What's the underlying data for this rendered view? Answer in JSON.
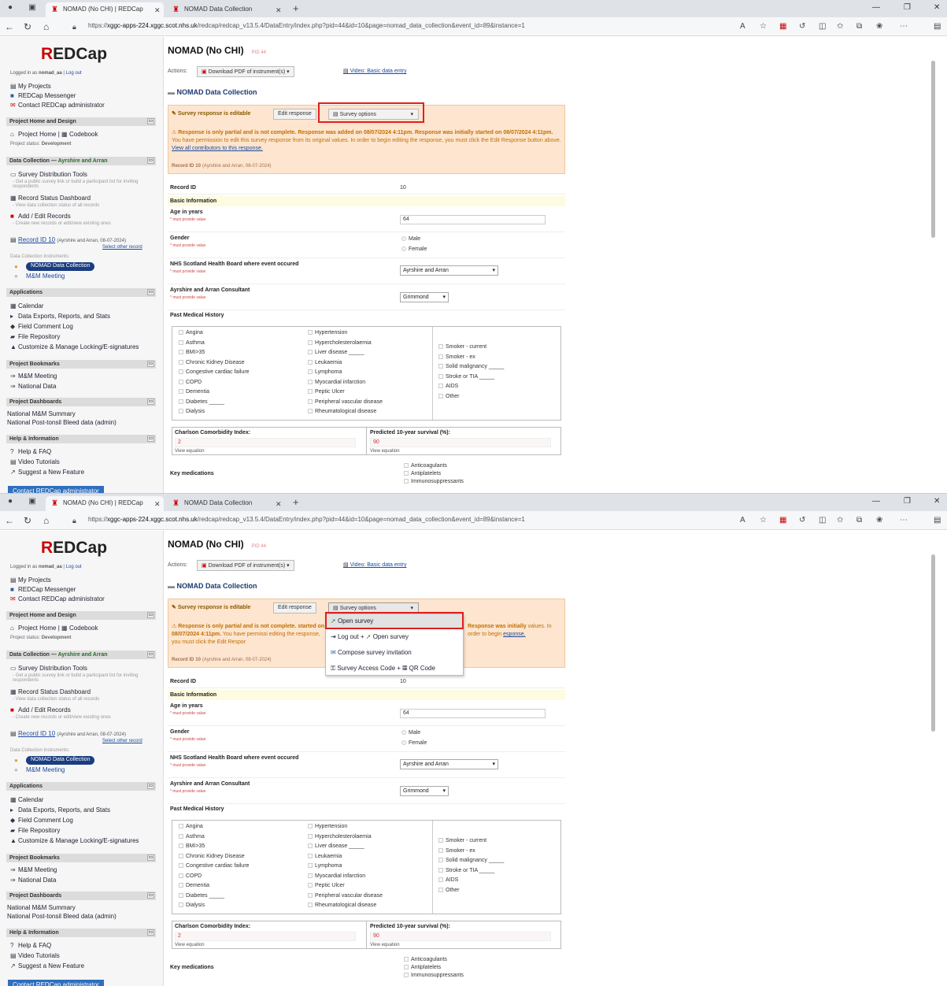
{
  "browser": {
    "tabs": [
      {
        "title": "NOMAD (No CHI) | REDCap"
      },
      {
        "title": "NOMAD Data Collection"
      }
    ],
    "url_prefix": "https://",
    "url_host": "xggc-apps-224.xggc.scot.nhs.uk",
    "url_path": "/redcap/redcap_v13.5.4/DataEntry/index.php?pid=44&id=10&page=nomad_data_collection&event_id=89&instance=1",
    "new_tab": "+"
  },
  "sidebar": {
    "logo_r": "R",
    "logo_rest": "EDCap",
    "logged_in_prefix": "Logged in as",
    "username": "nomad_aa",
    "sep": "|",
    "logout": "Log out",
    "top_links": [
      "My Projects",
      "REDCap Messenger",
      "Contact REDCap administrator"
    ],
    "sections": {
      "home_design": "Project Home and Design",
      "data_collection": "Data Collection",
      "data_collection_sub": "Ayrshire and Arran",
      "applications": "Applications",
      "bookmarks": "Project Bookmarks",
      "dashboards": "Project Dashboards",
      "help": "Help & Information"
    },
    "dash": "—",
    "collapse": "▭",
    "project_home": "Project Home",
    "codebook": "Codebook",
    "project_status_label": "Project status:",
    "project_status": "Development",
    "survey_tools": "Survey Distribution Tools",
    "survey_tools_desc": "- Get a public survey link or build a participant list for inviting respondents",
    "record_status": "Record Status Dashboard",
    "record_status_desc": "- View data collection status of all records",
    "add_edit": "Add / Edit Records",
    "add_edit_desc": "- Create new records or edit/view existing ones",
    "record_link": "Record ID 10",
    "record_ctx": "(Ayrshire and Arran, 08-07-2024)",
    "select_other": "Select other record",
    "instruments_label": "Data Collection Instruments:",
    "instruments": [
      "NOMAD Data Collection",
      "M&M Meeting"
    ],
    "applications": [
      "Calendar",
      "Data Exports, Reports, and Stats",
      "Field Comment Log",
      "File Repository",
      "Customize & Manage Locking/E-signatures"
    ],
    "bookmarks": [
      "M&M Meeting",
      "National Data"
    ],
    "dashboards": [
      "National M&M Summary",
      "National Post-tonsil Bleed data (admin)"
    ],
    "help": [
      "Help & FAQ",
      "Video Tutorials",
      "Suggest a New Feature"
    ],
    "contact_button": "Contact REDCap administrator"
  },
  "main": {
    "project_title": "NOMAD (No CHI)",
    "pid": "PID 44",
    "actions_label": "Actions:",
    "download_pdf": "Download PDF of instrument(s)",
    "video_link": "Video: Basic data entry",
    "form_title": "NOMAD Data Collection",
    "survey_editable": "Survey response is editable",
    "edit_response": "Edit response",
    "survey_options": "Survey options",
    "partial_bold": "Response is only partial and is not complete. Response was added on 08/07/2024 4:11pm. Response was initially started on 08/07/2024 4:11pm.",
    "partial_text": "You have permission to edit this survey response from its original values. In order to begin editing the response, you must click the Edit Response button above.",
    "contributors_link": "View all contributors to this response.",
    "record_id_label": "Record ID",
    "record_id_value": "10",
    "record_id_ctx": "(Ayrshire and Arran, 08-07-2024)",
    "shot2_partial_bold_a": "Response is only partial and is not complete.",
    "shot2_partial_bold_b": "Response was initially",
    "shot2_partial_bold_c": "started on 08/07/2024 4:11pm.",
    "shot2_partial_text_a": "You have permissi",
    "shot2_partial_text_b": "values. In order to begin",
    "shot2_partial_text_c": "editing the response, you must click the Edit Respor",
    "shot2_link_tail": "esponse."
  },
  "survey_menu": {
    "items": [
      "Open survey",
      "Log out + ",
      "Open survey",
      "Compose survey invitation",
      "Survey Access Code + ",
      "QR Code"
    ]
  },
  "form": {
    "basic_info": "Basic Information",
    "age_label": "Age in years",
    "required": "* must provide value",
    "age_value": "64",
    "gender_label": "Gender",
    "gender_options": [
      "Male",
      "Female"
    ],
    "board_label": "NHS Scotland Health Board where event occured",
    "board_value": "Ayrshire and Arran",
    "consultant_label": "Ayrshire and Arran Consultant",
    "consultant_value": "Grimmond",
    "pmh_label": "Past Medical History",
    "pmh_col1": [
      "Angina",
      "Asthma",
      "BMI>35",
      "Chronic Kidney Disease",
      "Congestive cardiac failure",
      "COPD",
      "Dementia",
      "Diabetes _____",
      "Dialysis"
    ],
    "pmh_col2": [
      "Hypertension",
      "Hypercholesterolaemia",
      "Liver disease _____",
      "Leukaemia",
      "Lymphoma",
      "Myocardial infarction",
      "Peptic Ulcer",
      "Peripheral vascular disease",
      "Rheumatological disease"
    ],
    "pmh_col3": [
      "Smoker - current",
      "Smoker - ex",
      "Solid malignancy _____",
      "Stroke or TIA _____",
      "AIDS",
      "Other"
    ],
    "charlson_label": "Charlson Comorbidity Index:",
    "charlson_value": "2",
    "survival_label": "Predicted 10-year survival (%):",
    "survival_value": "90",
    "view_equation": "View equation",
    "meds_label": "Key medications",
    "meds_options": [
      "Anticoagulants",
      "Antiplatelets",
      "Immunosuppressants"
    ]
  },
  "colors": {
    "accent": "#c00000",
    "highlight": "#e02020",
    "survey_bg": "#fde5cf",
    "nav": "#1a3d80"
  }
}
